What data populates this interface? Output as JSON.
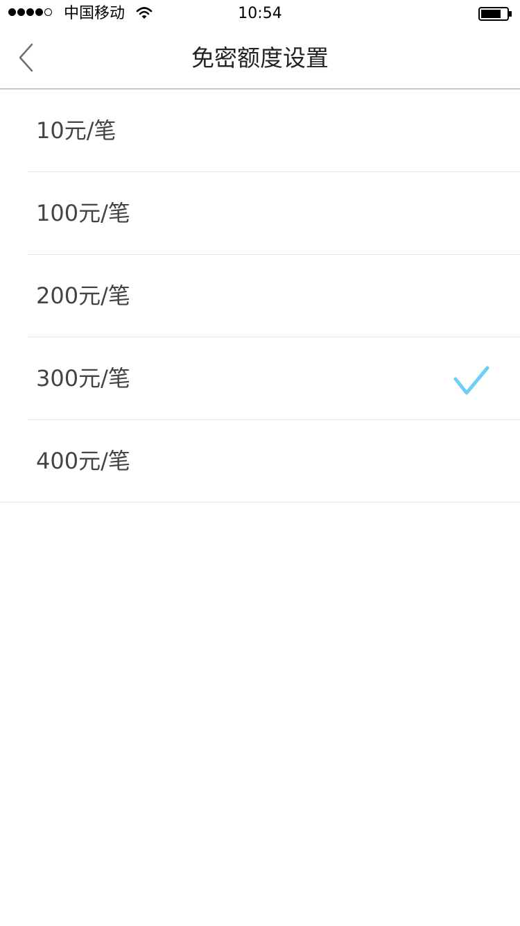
{
  "status_bar": {
    "carrier": "中国移动",
    "time": "10:54",
    "signal_strength": "4 of 5",
    "icons": [
      "signal-dots-icon",
      "wifi-icon",
      "battery-icon"
    ]
  },
  "nav": {
    "title": "免密额度设置",
    "back_icon": "chevron-left-icon"
  },
  "options": [
    {
      "label": "10元/笔",
      "selected": false
    },
    {
      "label": "100元/笔",
      "selected": false
    },
    {
      "label": "200元/笔",
      "selected": false
    },
    {
      "label": "300元/笔",
      "selected": true
    },
    {
      "label": "400元/笔",
      "selected": false
    }
  ],
  "colors": {
    "accent": "#6ccff6",
    "divider": "#e6e6e6",
    "text": "#444444"
  }
}
